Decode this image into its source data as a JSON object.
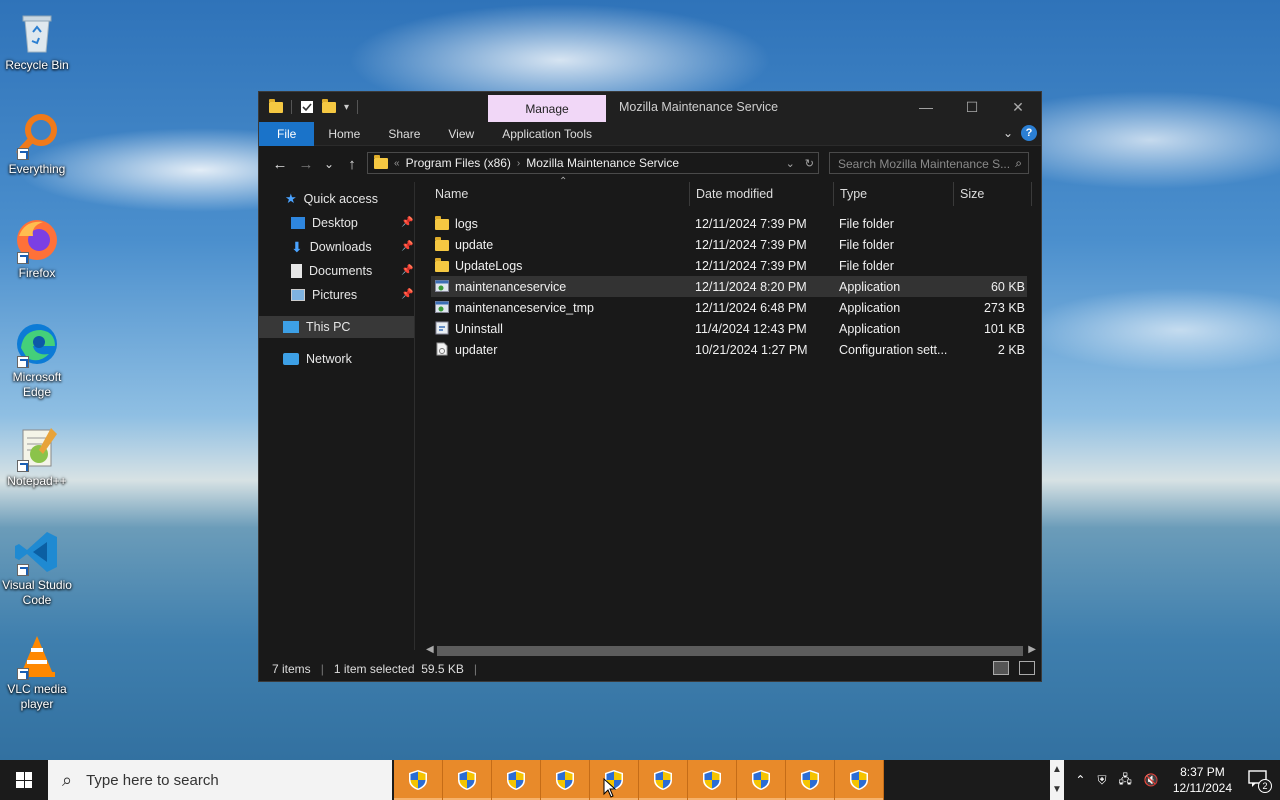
{
  "desktop": {
    "icons": [
      {
        "label": "Recycle Bin",
        "icon": "recycle-bin-icon"
      },
      {
        "label": "Everything",
        "icon": "everything-search-icon"
      },
      {
        "label": "Firefox",
        "icon": "firefox-icon"
      },
      {
        "label": "Microsoft Edge",
        "icon": "edge-icon"
      },
      {
        "label": "Notepad++",
        "icon": "notepadpp-icon"
      },
      {
        "label": "Visual Studio Code",
        "icon": "vscode-icon"
      },
      {
        "label": "VLC media player",
        "icon": "vlc-icon"
      }
    ]
  },
  "window": {
    "title": "Mozilla Maintenance Service",
    "context_tab": "Manage",
    "controls": {
      "minimize": "—",
      "maximize": "☐",
      "close": "✕"
    },
    "ribbon_tabs": [
      "File",
      "Home",
      "Share",
      "View",
      "Application Tools"
    ],
    "help": "?",
    "nav": {
      "back": "←",
      "forward": "→",
      "recent": "⌄",
      "up": "↑"
    },
    "address": {
      "segments": [
        "Program Files (x86)",
        "Mozilla Maintenance Service"
      ],
      "sep": "›",
      "lead": "«"
    },
    "search_placeholder": "Search Mozilla Maintenance S...",
    "nav_pane": {
      "quick_access": "Quick access",
      "pinned": [
        "Desktop",
        "Downloads",
        "Documents",
        "Pictures"
      ],
      "this_pc": "This PC",
      "network": "Network"
    },
    "columns": {
      "name": "Name",
      "date": "Date modified",
      "type": "Type",
      "size": "Size"
    },
    "files": [
      {
        "name": "logs",
        "date": "12/11/2024 7:39 PM",
        "type": "File folder",
        "size": "",
        "icon": "folder-icon"
      },
      {
        "name": "update",
        "date": "12/11/2024 7:39 PM",
        "type": "File folder",
        "size": "",
        "icon": "folder-icon"
      },
      {
        "name": "UpdateLogs",
        "date": "12/11/2024 7:39 PM",
        "type": "File folder",
        "size": "",
        "icon": "folder-icon"
      },
      {
        "name": "maintenanceservice",
        "date": "12/11/2024 8:20 PM",
        "type": "Application",
        "size": "60 KB",
        "icon": "app-icon"
      },
      {
        "name": "maintenanceservice_tmp",
        "date": "12/11/2024 6:48 PM",
        "type": "Application",
        "size": "273 KB",
        "icon": "app-icon"
      },
      {
        "name": "Uninstall",
        "date": "11/4/2024 12:43 PM",
        "type": "Application",
        "size": "101 KB",
        "icon": "uninstall-icon"
      },
      {
        "name": "updater",
        "date": "10/21/2024 1:27 PM",
        "type": "Configuration sett...",
        "size": "2 KB",
        "icon": "config-file-icon"
      }
    ],
    "status": {
      "items": "7 items",
      "selected": "1 item selected  59.5 KB"
    }
  },
  "taskbar": {
    "search_placeholder": "Type here to search",
    "app_count": 10,
    "time": "8:37 PM",
    "date": "12/11/2024",
    "notifications": "2"
  },
  "colors": {
    "accent": "#1a73c9",
    "manage_tab": "#f1d7f7",
    "taskbar_app": "#e88a2a"
  }
}
